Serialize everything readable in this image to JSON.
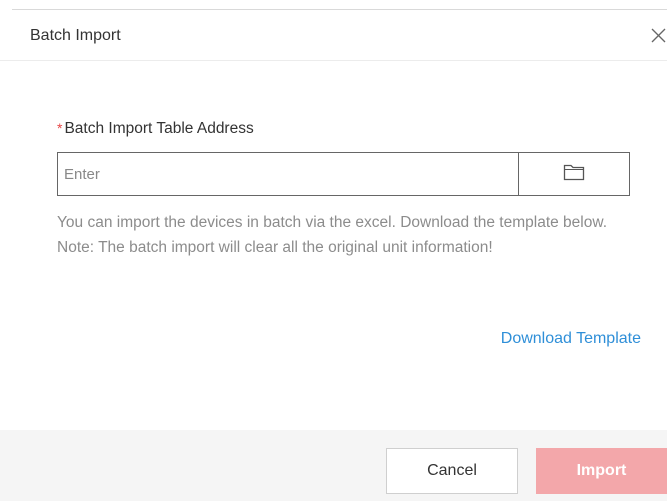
{
  "dialog": {
    "title": "Batch Import",
    "close_icon": "close-icon"
  },
  "form": {
    "required_mark": "*",
    "label": "Batch Import Table Address",
    "path_placeholder": "Enter",
    "path_value": "",
    "browse_icon": "folder-icon",
    "help_text": "You can import the devices in batch via the excel. Download the template below. Note: The batch import will clear all the original unit information!",
    "download_link": "Download Template"
  },
  "footer": {
    "cancel_label": "Cancel",
    "import_label": "Import",
    "import_enabled": false
  },
  "colors": {
    "required": "#e64545",
    "link": "#2f8fd8",
    "import_disabled": "#f3a7aa",
    "footer_bg": "#f5f5f5"
  }
}
